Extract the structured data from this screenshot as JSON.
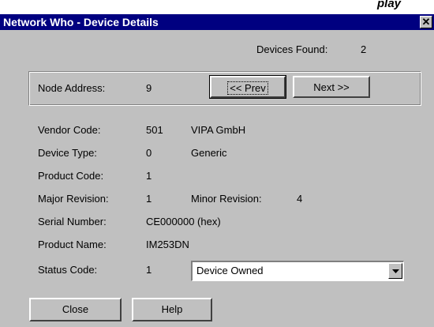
{
  "background_caption": "play",
  "window": {
    "title": "Network Who - Device Details",
    "close_glyph": "✕"
  },
  "devices_found": {
    "label": "Devices Found:",
    "value": "2"
  },
  "node": {
    "label": "Node Address:",
    "value": "9",
    "prev_button": "<< Prev",
    "next_button": "Next >>"
  },
  "details": {
    "vendor_code_label": "Vendor Code:",
    "vendor_code": "501",
    "vendor_name": "VIPA GmbH",
    "device_type_label": "Device Type:",
    "device_type": "0",
    "device_type_name": "Generic",
    "product_code_label": "Product Code:",
    "product_code": "1",
    "major_revision_label": "Major Revision:",
    "major_revision": "1",
    "minor_revision_label": "Minor Revision:",
    "minor_revision": "4",
    "serial_number_label": "Serial Number:",
    "serial_number": "CE000000 (hex)",
    "product_name_label": "Product Name:",
    "product_name": "IM253DN",
    "status_code_label": "Status Code:",
    "status_code": "1",
    "status_select": "Device Owned"
  },
  "footer": {
    "close_button": "Close",
    "help_button": "Help"
  },
  "icons": {
    "close": "close-icon",
    "dropdown": "chevron-down-icon"
  }
}
